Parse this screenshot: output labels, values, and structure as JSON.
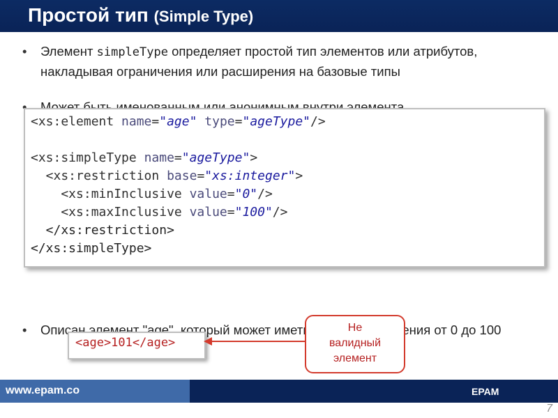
{
  "title": {
    "main": "Простой тип",
    "sub": "(Simple Type)"
  },
  "bullets": {
    "b1_before": "Элемент ",
    "b1_code": "simpleType",
    "b1_after": " определяет простой тип элементов или атрибутов, накладывая ограничения или расширения на базовые типы",
    "b2": "Может быть именованным или анонимным внутри элемента",
    "b3": "Описан элемент \"age\", который может иметь числовые значения от 0 до 100"
  },
  "code": {
    "l1": {
      "open": "<xs:element ",
      "a1": "name",
      "eq1": "=",
      "v1": "\"age\"",
      "sp": " ",
      "a2": "type",
      "eq2": "=",
      "v2": "\"ageType\"",
      "close": "/>"
    },
    "l3": {
      "open": "<xs:simpleType ",
      "a1": "name",
      "eq1": "=",
      "v1": "\"ageType\"",
      "close": ">"
    },
    "l4": {
      "open": "  <xs:restriction ",
      "a1": "base",
      "eq1": "=",
      "v1": "\"xs:integer\"",
      "close": ">"
    },
    "l5": {
      "open": "    <xs:minInclusive ",
      "a1": "value",
      "eq1": "=",
      "v1": "\"0\"",
      "close": "/>"
    },
    "l6": {
      "open": "    <xs:maxInclusive ",
      "a1": "value",
      "eq1": "=",
      "v1": "\"100\"",
      "close": "/>"
    },
    "l7": "  </xs:restriction>",
    "l8": "</xs:simpleType>"
  },
  "example": "<age>101</age>",
  "callout": "Не\nвалидный\nэлемент",
  "footer": {
    "url": "www.epam.co",
    "brand": "EPAM\nSystems"
  },
  "page_number": "7",
  "colors": {
    "title_bg": "#0a2357",
    "footer_left": "#3f6aa8",
    "callout_border": "#d33a2c",
    "callout_text": "#b51f1f"
  }
}
